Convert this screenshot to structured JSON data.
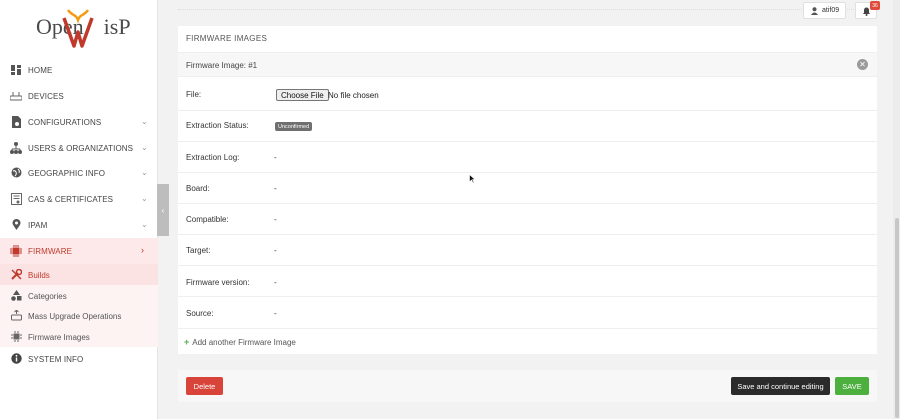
{
  "brand": {
    "logo_text_left": "Open",
    "logo_text_right": "isP",
    "accent": "#c0392b"
  },
  "sidebar": {
    "items": [
      {
        "label": "HOME",
        "icon": "dashboard-icon",
        "chevron": ""
      },
      {
        "label": "DEVICES",
        "icon": "router-icon",
        "chevron": ""
      },
      {
        "label": "CONFIGURATIONS",
        "icon": "config-file-icon",
        "chevron": "⌄"
      },
      {
        "label": "USERS & ORGANIZATIONS",
        "icon": "org-tree-icon",
        "chevron": "⌄"
      },
      {
        "label": "GEOGRAPHIC INFO",
        "icon": "globe-icon",
        "chevron": "⌄"
      },
      {
        "label": "CAS & CERTIFICATES",
        "icon": "certificate-icon",
        "chevron": "⌄"
      },
      {
        "label": "IPAM",
        "icon": "map-pin-icon",
        "chevron": "⌄"
      },
      {
        "label": "FIRMWARE",
        "icon": "chip-icon",
        "chevron": "›"
      },
      {
        "label": "SYSTEM INFO",
        "icon": "info-icon",
        "chevron": ""
      }
    ],
    "firmware_sub": [
      {
        "label": "Builds",
        "icon": "tools-icon"
      },
      {
        "label": "Categories",
        "icon": "shapes-icon"
      },
      {
        "label": "Mass Upgrade Operations",
        "icon": "upgrade-icon"
      },
      {
        "label": "Firmware Images",
        "icon": "chip-small-icon"
      }
    ],
    "collapse_glyph": "‹"
  },
  "topbar": {
    "username": "atif09",
    "notifications": "36"
  },
  "main": {
    "section_title": "FIRMWARE IMAGES",
    "inline_title": "Firmware Image:  #1",
    "remove_glyph": "✕",
    "file_label": "File:",
    "file_button": "Choose File",
    "file_status": "No file chosen",
    "fields": [
      {
        "label": "Extraction Status:",
        "value": "Unconfirmed"
      },
      {
        "label": "Extraction Log:",
        "value": "-"
      },
      {
        "label": "Board:",
        "value": "-"
      },
      {
        "label": "Compatible:",
        "value": "-"
      },
      {
        "label": "Target:",
        "value": "-"
      },
      {
        "label": "Firmware version:",
        "value": "-"
      },
      {
        "label": "Source:",
        "value": "-"
      }
    ],
    "add_another": "Add another Firmware Image",
    "add_plus": "+"
  },
  "footer": {
    "delete": "Delete",
    "save_continue": "Save and continue editing",
    "save": "SAVE"
  }
}
